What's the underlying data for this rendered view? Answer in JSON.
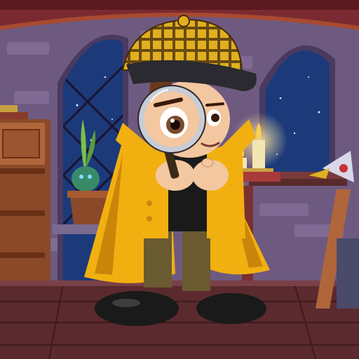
{
  "scene": {
    "colors": {
      "wall": "#6e5a80",
      "brick_light": "#8a76a0",
      "brick_dark": "#5a4870",
      "ceiling_beam": "#7a2a30",
      "floor": "#5a2a2e",
      "floor_plank": "#6e3236",
      "night_sky": "#1c3a7a",
      "star": "#d8e6ff",
      "wood": "#8a4a2a",
      "wood_light": "#b0663a",
      "coat": "#f2b010",
      "coat_shadow": "#c9860a",
      "hat": "#e0b020",
      "hat_check": "#6a4a10",
      "cap_brim": "#2a2a30",
      "skin": "#f3c7a0",
      "hair": "#6a3a1a",
      "shirt": "#1a1a1a",
      "pants": "#6a5a30",
      "shoe": "#1a1a1a",
      "lens_rim": "#c8ccd4",
      "candle_glow": "#ffe6a0",
      "plant": "#7ac04a",
      "plant_pot": "#5a3a8a"
    },
    "icons": {
      "magnifier": "magnifying-glass-icon",
      "candle": "candle-icon",
      "plant": "sprout-icon"
    }
  }
}
